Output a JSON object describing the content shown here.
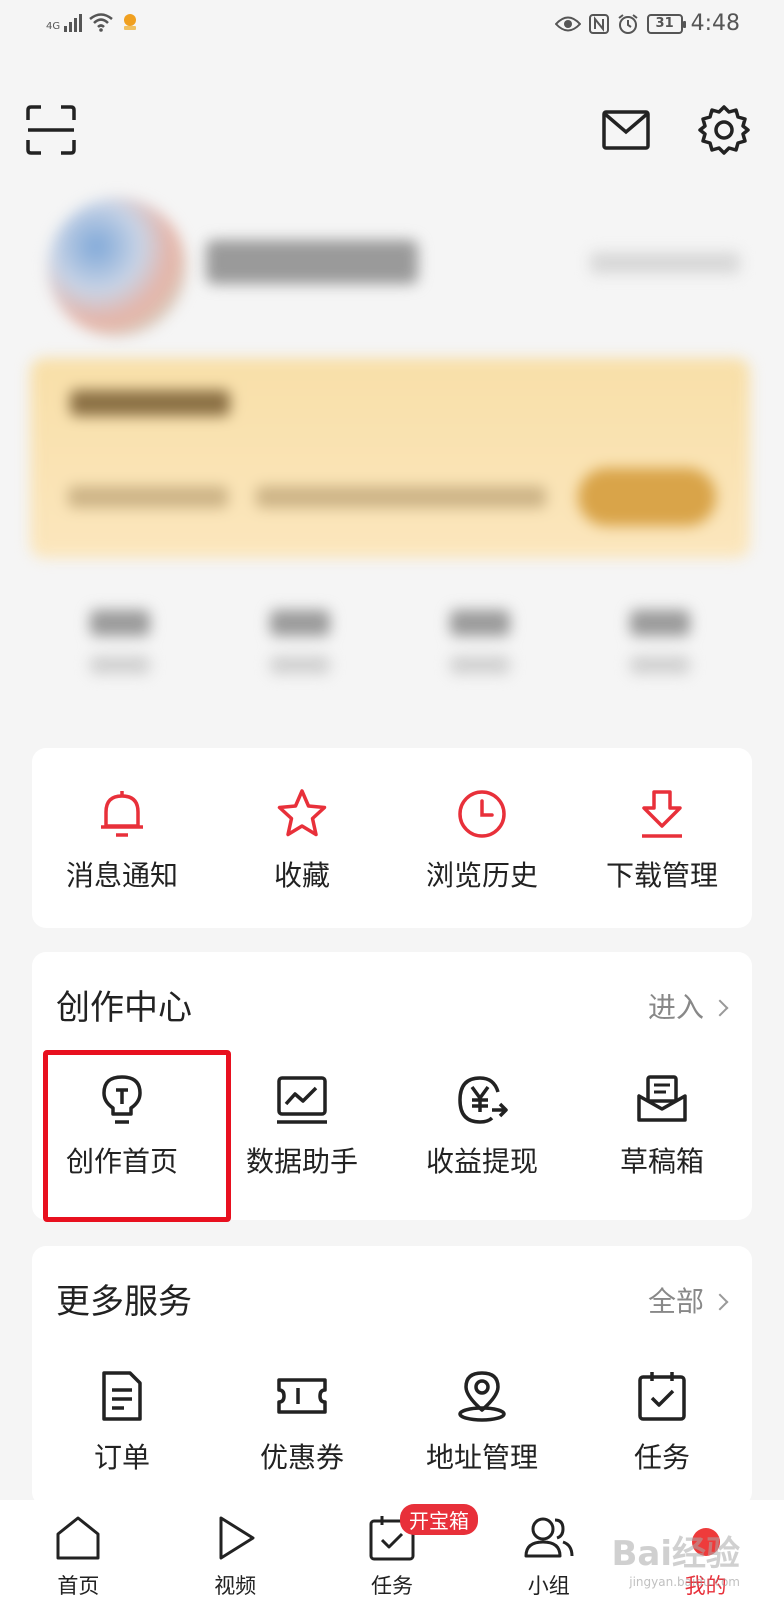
{
  "status_bar": {
    "network": "4G",
    "battery": "31",
    "time": "4:48"
  },
  "quick_actions": [
    {
      "label": "消息通知",
      "icon": "bell-icon"
    },
    {
      "label": "收藏",
      "icon": "star-icon"
    },
    {
      "label": "浏览历史",
      "icon": "clock-icon"
    },
    {
      "label": "下载管理",
      "icon": "download-icon"
    }
  ],
  "creation_center": {
    "title": "创作中心",
    "link": "进入",
    "items": [
      {
        "label": "创作首页",
        "icon": "lightbulb-icon"
      },
      {
        "label": "数据助手",
        "icon": "chart-icon"
      },
      {
        "label": "收益提现",
        "icon": "yuan-exchange-icon"
      },
      {
        "label": "草稿箱",
        "icon": "draft-box-icon"
      }
    ]
  },
  "more_services": {
    "title": "更多服务",
    "link": "全部",
    "items": [
      {
        "label": "订单",
        "icon": "document-icon"
      },
      {
        "label": "优惠券",
        "icon": "ticket-icon"
      },
      {
        "label": "地址管理",
        "icon": "location-pin-icon"
      },
      {
        "label": "任务",
        "icon": "calendar-check-icon"
      }
    ]
  },
  "bottom_nav": [
    {
      "label": "首页",
      "icon": "home-icon"
    },
    {
      "label": "视频",
      "icon": "play-icon"
    },
    {
      "label": "任务",
      "icon": "task-calendar-icon",
      "badge": "开宝箱"
    },
    {
      "label": "小组",
      "icon": "group-icon"
    },
    {
      "label": "我的",
      "icon": "profile-dot-icon",
      "active": true
    }
  ],
  "watermark": {
    "text": "Bai经验",
    "sub": "jingyan.baidu.com"
  },
  "colors": {
    "accent_red": "#e8303a",
    "highlight_red": "#e8101f",
    "background": "#f5f5f5"
  }
}
